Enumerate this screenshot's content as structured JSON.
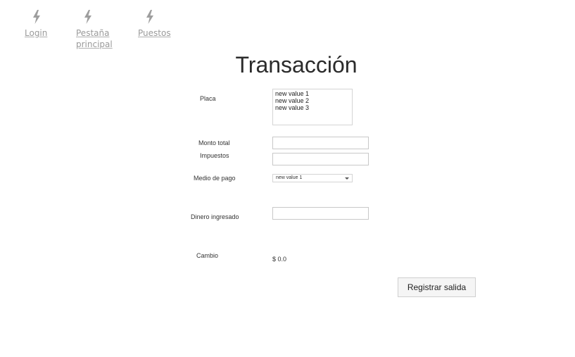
{
  "nav": {
    "items": [
      {
        "label": "Login",
        "icon": "bolt-icon"
      },
      {
        "label": "Pestaña principal",
        "icon": "bolt-icon"
      },
      {
        "label": "Puestos",
        "icon": "bolt-icon"
      }
    ],
    "icon_color": "#9e9e9e"
  },
  "page": {
    "title": "Transacción"
  },
  "form": {
    "placa": {
      "label": "Placa",
      "options": [
        "new value 1",
        "new value 2",
        "new value 3"
      ]
    },
    "monto_total": {
      "label": "Monto total",
      "value": ""
    },
    "impuestos": {
      "label": "Impuestos",
      "value": ""
    },
    "medio_de_pago": {
      "label": "Medio de pago",
      "selected": "new value 1"
    },
    "dinero_ingresado": {
      "label": "Dinero ingresado",
      "value": ""
    },
    "cambio": {
      "label": "Cambio",
      "value": "$ 0.0"
    },
    "submit_label": "Registrar salida"
  }
}
